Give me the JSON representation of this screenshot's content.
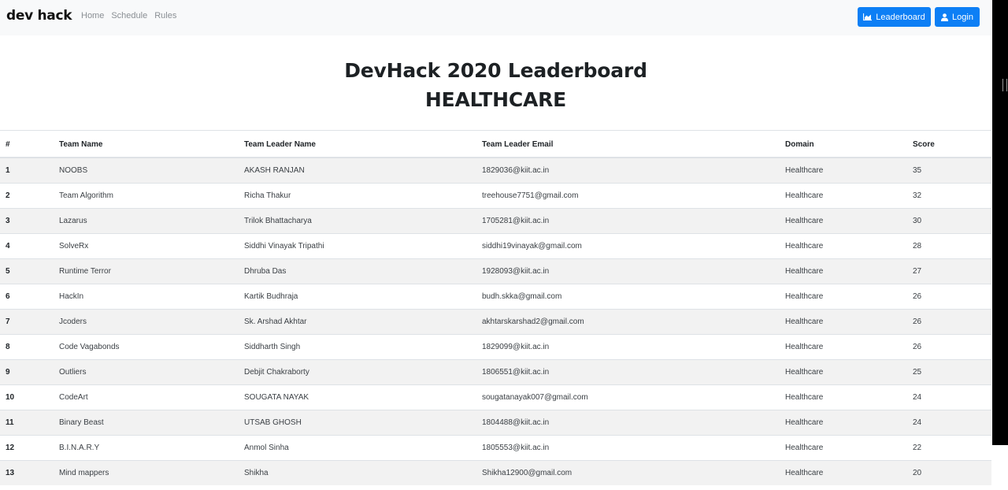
{
  "navbar": {
    "brand": "dev hack",
    "links": [
      "Home",
      "Schedule",
      "Rules"
    ],
    "leaderboard_button": "Leaderboard",
    "login_button": "Login",
    "accent_color": "#0d7ff5"
  },
  "page": {
    "title": "DevHack 2020 Leaderboard",
    "subtitle": "HEALTHCARE"
  },
  "table": {
    "columns": [
      "#",
      "Team Name",
      "Team Leader Name",
      "Team Leader Email",
      "Domain",
      "Score"
    ],
    "rows": [
      [
        "1",
        "NOOBS",
        "AKASH RANJAN",
        "1829036@kiit.ac.in",
        "Healthcare",
        "35"
      ],
      [
        "2",
        "Team Algorithm",
        "Richa Thakur",
        "treehouse7751@gmail.com",
        "Healthcare",
        "32"
      ],
      [
        "3",
        "Lazarus",
        "Trilok Bhattacharya",
        "1705281@kiit.ac.in",
        "Healthcare",
        "30"
      ],
      [
        "4",
        "SolveRx",
        "Siddhi Vinayak Tripathi",
        "siddhi19vinayak@gmail.com",
        "Healthcare",
        "28"
      ],
      [
        "5",
        "Runtime Terror",
        "Dhruba Das",
        "1928093@kiit.ac.in",
        "Healthcare",
        "27"
      ],
      [
        "6",
        "HackIn",
        "Kartik Budhraja",
        "budh.skka@gmail.com",
        "Healthcare",
        "26"
      ],
      [
        "7",
        "Jcoders",
        "Sk. Arshad Akhtar",
        "akhtarskarshad2@gmail.com",
        "Healthcare",
        "26"
      ],
      [
        "8",
        "Code Vagabonds",
        "Siddharth Singh",
        "1829099@kiit.ac.in",
        "Healthcare",
        "26"
      ],
      [
        "9",
        "Outliers",
        "Debjit Chakraborty",
        "1806551@kiit.ac.in",
        "Healthcare",
        "25"
      ],
      [
        "10",
        "CodeArt",
        "SOUGATA NAYAK",
        "sougatanayak007@gmail.com",
        "Healthcare",
        "24"
      ],
      [
        "11",
        "Binary Beast",
        "UTSAB GHOSH",
        "1804488@kiit.ac.in",
        "Healthcare",
        "24"
      ],
      [
        "12",
        "B.I.N.A.R.Y",
        "Anmol Sinha",
        "1805553@kiit.ac.in",
        "Healthcare",
        "22"
      ],
      [
        "13",
        "Mind mappers",
        "Shikha",
        "Shikha12900@gmail.com",
        "Healthcare",
        "20"
      ]
    ]
  },
  "icons": {
    "leaderboard": "chart-area-icon",
    "login": "user-icon"
  }
}
